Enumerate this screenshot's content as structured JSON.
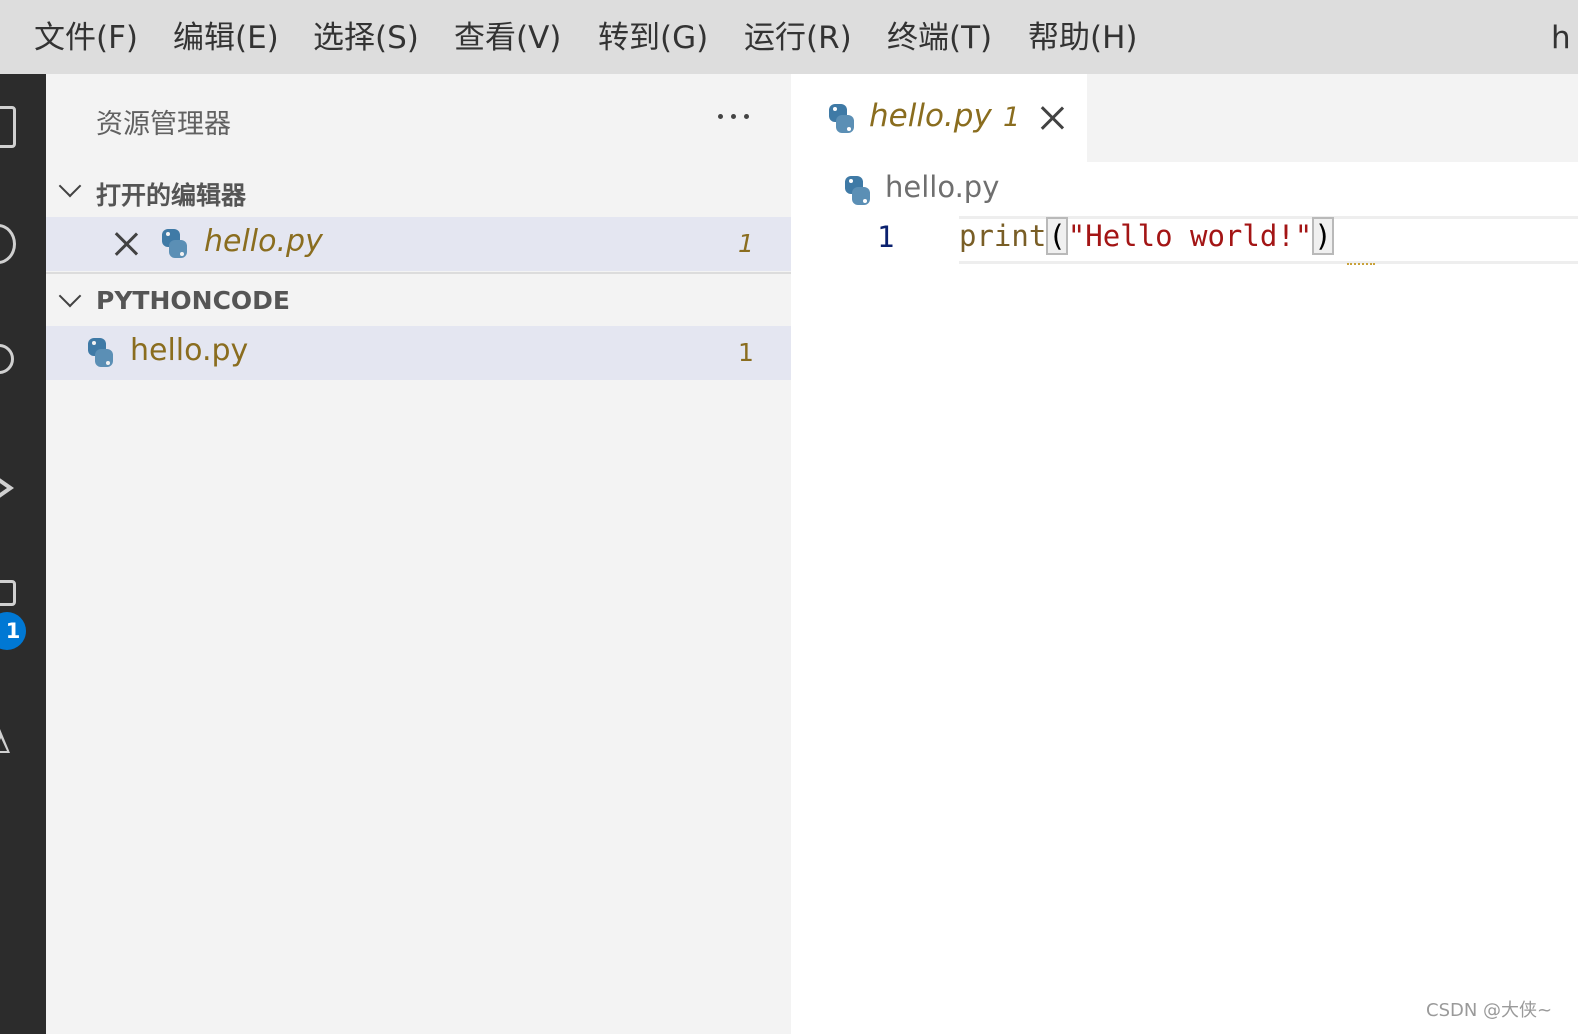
{
  "menu": {
    "items": [
      "文件(F)",
      "编辑(E)",
      "选择(S)",
      "查看(V)",
      "转到(G)",
      "运行(R)",
      "终端(T)",
      "帮助(H)"
    ],
    "title_fragment": "h"
  },
  "activity_bar": {
    "badge_count": "1",
    "icons": [
      "files-icon",
      "search-icon",
      "source-control-icon",
      "run-debug-icon",
      "extensions-icon",
      "testing-icon"
    ]
  },
  "sidebar": {
    "title": "资源管理器",
    "open_editors": {
      "label": "打开的编辑器",
      "items": [
        {
          "name": "hello.py",
          "problems": "1"
        }
      ]
    },
    "folder": {
      "label": "PYTHONCODE",
      "items": [
        {
          "name": "hello.py",
          "problems": "1"
        }
      ]
    }
  },
  "editor": {
    "tab": {
      "name": "hello.py",
      "problems": "1"
    },
    "breadcrumb": "hello.py",
    "lines": [
      {
        "number": "1",
        "fn": "print",
        "open_paren": "(",
        "string": "\"Hello world!\"",
        "close_paren": ")"
      }
    ]
  },
  "watermark": "CSDN @大侠~",
  "colors": {
    "activity_bar": "#2c2c2c",
    "badge": "#0078d4",
    "modified_file": "#8a6d1f",
    "string": "#a31515",
    "function": "#795e26"
  }
}
